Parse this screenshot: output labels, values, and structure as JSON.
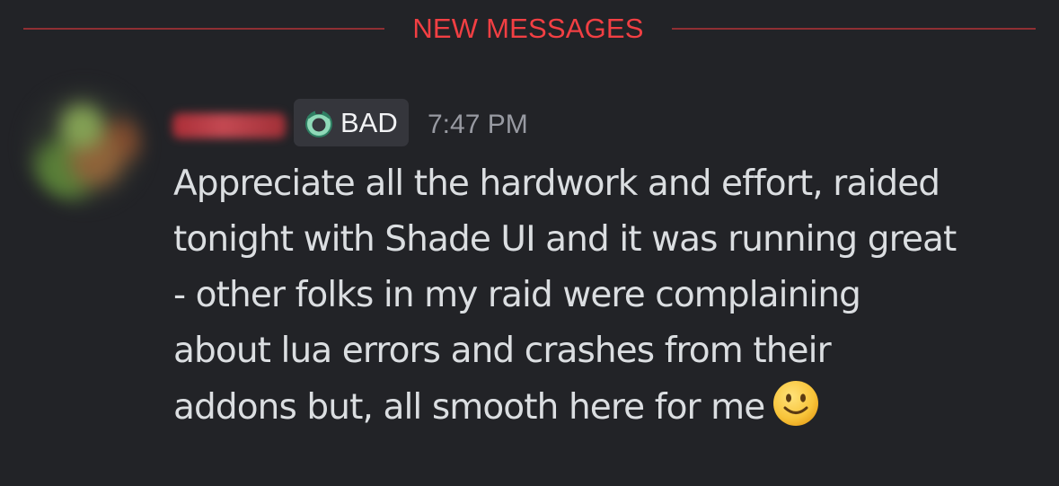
{
  "divider": {
    "label": "NEW MESSAGES",
    "color": "#f23f43"
  },
  "message": {
    "author_name_redacted": true,
    "role_badge": {
      "label": "BAD",
      "icon": "ring-icon"
    },
    "timestamp": "7:47 PM",
    "lines": [
      "Appreciate all the hardwork and effort, raided",
      "tonight with Shade UI and it was running great",
      "- other folks in my raid were complaining",
      "about lua errors and crashes from their",
      "addons but, all smooth here for me"
    ],
    "emoji": "slightly-smiling-face-icon"
  },
  "colors": {
    "background": "#222327",
    "text": "#dbdee1",
    "timestamp": "#989aa2",
    "badge_background": "#35363c"
  }
}
